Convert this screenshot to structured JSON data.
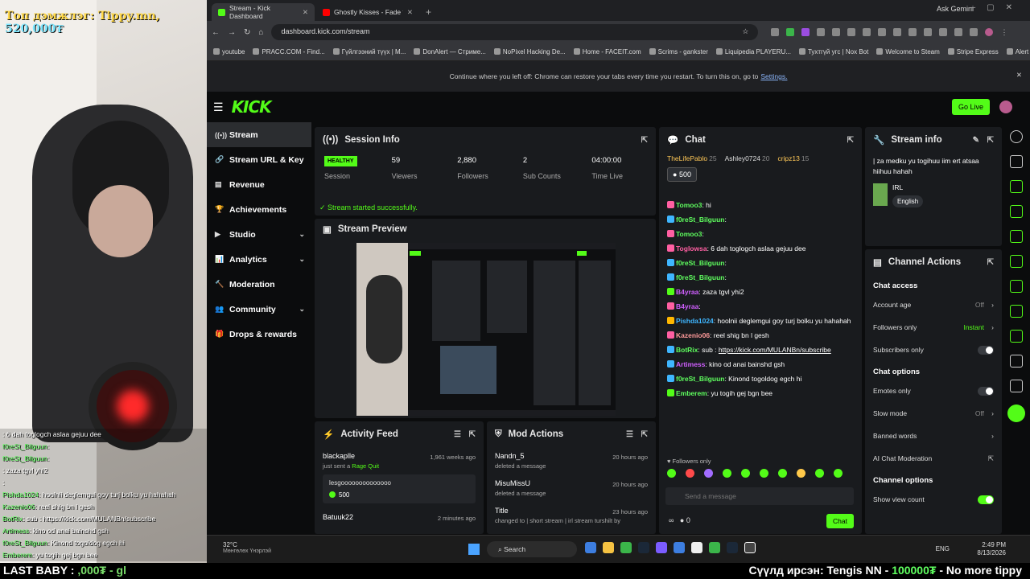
{
  "overlay": {
    "tip_prefix": "Топ дэмжлэг:",
    "tip_name": "Tippy.mn",
    "tip_amount": "520,000₮",
    "chat": [
      {
        "user": "",
        "text": ": 6 dah toglogch aslaa gejuu dee"
      },
      {
        "user": "f0reSt_Bilguun",
        "text": ":"
      },
      {
        "user": "f0reSt_Bilguun",
        "text": ":"
      },
      {
        "user": "",
        "text": ": zaza tgvl yhi2"
      },
      {
        "user": "",
        "text": ":"
      },
      {
        "user": "Pishda1024",
        "text": ": hoolnii deglemgui goy turj bolku yu hahahah"
      },
      {
        "user": "Kazenio06",
        "text": ": reel shig bn l gesh"
      },
      {
        "user": "BotRix",
        "text": ": sub : https://kick.com/MULANBn/subscribe"
      },
      {
        "user": "Artimess",
        "text": ": kino od anai bainshd gsh"
      },
      {
        "user": "f0reSt_Bilguun",
        "text": ": Kinond togoldog egch hi"
      },
      {
        "user": "Emberem",
        "text": ": yu togih gej bgn bee"
      }
    ],
    "bottom_left_label": "LAST BABY :",
    "bottom_left_value": ",000₮ - gl",
    "bottom_right_prefix": "Сүүлд ирсэн:",
    "bottom_right_name": "Tengis NN -",
    "bottom_right_amount": "100000₮",
    "bottom_right_suffix": "- No more tippy"
  },
  "browser": {
    "tabs": [
      {
        "title": "Stream - Kick Dashboard",
        "active": true
      },
      {
        "title": "Ghostly Kisses - Fade from Me",
        "active": false
      }
    ],
    "ask_gemini": "Ask Gemini",
    "url": "dashboard.kick.com/stream",
    "bookmarks": [
      "youtube",
      "PRACC.COM - Find...",
      "Гүйлгээний түүх | M...",
      "DonAlert — Стриме...",
      "NoPixel Hacking De...",
      "Home - FACEIT.com",
      "Scrims - gankster",
      "Liquipedia PLAYERU...",
      "Тухтгүй угс | Nox Bot",
      "Welcome to Steam",
      "Stripe Express",
      "Alert Box / Streamla...",
      "All Bookmarks"
    ],
    "restore_text": "Continue where you left off: Chrome can restore your tabs every time you restart. To turn this on, go to",
    "restore_link": "Settings."
  },
  "kick": {
    "logo": "KICK",
    "go_live": "Go Live",
    "nav": [
      {
        "label": "Stream",
        "icon": "((•))",
        "chev": ""
      },
      {
        "label": "Stream URL & Key",
        "icon": "🔗",
        "chev": ""
      },
      {
        "label": "Revenue",
        "icon": "▤",
        "chev": ""
      },
      {
        "label": "Achievements",
        "icon": "🏆",
        "chev": ""
      },
      {
        "label": "Studio",
        "icon": "▶",
        "chev": "⌄"
      },
      {
        "label": "Analytics",
        "icon": "📊",
        "chev": "⌄"
      },
      {
        "label": "Moderation",
        "icon": "🔨",
        "chev": ""
      },
      {
        "label": "Community",
        "icon": "👥",
        "chev": "⌄"
      },
      {
        "label": "Drops & rewards",
        "icon": "🎁",
        "chev": ""
      }
    ],
    "session": {
      "title": "Session Info",
      "badge": "HEALTHY",
      "badge_label": "Session",
      "stats": [
        {
          "value": "59",
          "label": "Viewers"
        },
        {
          "value": "2,880",
          "label": "Followers"
        },
        {
          "value": "2",
          "label": "Sub Counts"
        },
        {
          "value": "04:00:00",
          "label": "Time Live"
        }
      ],
      "success": "Stream started successfully."
    },
    "preview_title": "Stream Preview",
    "activity": {
      "title": "Activity Feed",
      "items": [
        {
          "name": "blackaplle",
          "sub": "just sent a",
          "sub_bold": "Rage Quit",
          "time": "1,961 weeks ago",
          "msg": "lesgoooooooooooooo",
          "amount": "500"
        },
        {
          "name": "Batuuk22",
          "sub": "",
          "sub_bold": "",
          "time": "2 minutes ago",
          "msg": "",
          "amount": ""
        }
      ]
    },
    "mod": {
      "title": "Mod Actions",
      "items": [
        {
          "name": "Nandn_5",
          "sub": "deleted a message",
          "time": "20 hours ago"
        },
        {
          "name": "MisuMissU",
          "sub": "deleted a message",
          "time": "20 hours ago"
        },
        {
          "name": "Title",
          "sub": "changed to | short stream | irl stream turshilt by",
          "time": "23 hours ago"
        }
      ]
    },
    "chat": {
      "title": "Chat",
      "top_users": [
        {
          "name": "TheLifePablo",
          "count": "25"
        },
        {
          "name": "Ashley0724",
          "count": "20"
        },
        {
          "name": "cripz13",
          "count": "15"
        }
      ],
      "pinned_amount": "500",
      "lines": [
        {
          "user": "Tomoo3",
          "color": "#5fff5f",
          "text": ": hi",
          "badge": "#ff5fa2"
        },
        {
          "user": "f0reSt_Bilguun",
          "color": "#5fff5f",
          "text": ":",
          "badge": "#3fb6ff"
        },
        {
          "user": "Tomoo3",
          "color": "#5fff5f",
          "text": ":",
          "badge": "#ff5fa2"
        },
        {
          "user": "Toglowsa",
          "color": "#ff5fa2",
          "text": ": 6 dah toglogch aslaa gejuu dee",
          "badge": "#ff5fa2"
        },
        {
          "user": "f0reSt_Bilguun",
          "color": "#5fff5f",
          "text": ":",
          "badge": "#3fb6ff"
        },
        {
          "user": "f0reSt_Bilguun",
          "color": "#5fff5f",
          "text": ":",
          "badge": "#3fb6ff"
        },
        {
          "user": "B4yraa",
          "color": "#d05fff",
          "text": ": zaza tgvl yhi2",
          "badge": "#53fc18"
        },
        {
          "user": "B4yraa",
          "color": "#d05fff",
          "text": ":",
          "badge": "#ff5fa2"
        },
        {
          "user": "Pishda1024",
          "color": "#3fb6ff",
          "text": ": hoolnii deglemgui goy turj bolku yu hahahah",
          "badge": "#ffb700"
        },
        {
          "user": "Kazenio06",
          "color": "#ff9a9a",
          "text": ": reel shig bn l gesh",
          "badge": "#ff5fa2"
        },
        {
          "user": "BotRix",
          "color": "#5fff5f",
          "text": ": sub :",
          "link": "https://kick.com/MULANBn/subscribe",
          "badge": "#3fb6ff"
        },
        {
          "user": "Artimess",
          "color": "#d05fff",
          "text": ": kino od anai bainshd gsh",
          "badge": "#3fb6ff"
        },
        {
          "user": "f0reSt_Bilguun",
          "color": "#5fff5f",
          "text": ": Kinond togoldog egch hi",
          "badge": "#3fb6ff"
        },
        {
          "user": "Emberem",
          "color": "#5fff5f",
          "text": ": yu togih gej bgn bee",
          "badge": "#53fc18"
        }
      ],
      "followers_only": "Followers only",
      "placeholder": "Send a message",
      "infinite": "∞",
      "points": "0",
      "send_label": "Chat"
    },
    "stream_info": {
      "title": "Stream info",
      "stream_title": "| za medku yu togihuu iim ert atsaa hiihuu hahah",
      "category": "IRL",
      "language": "English"
    },
    "channel_actions": {
      "title": "Channel Actions",
      "chat_access": "Chat access",
      "account_age": "Account age",
      "account_age_val": "Off",
      "followers_only": "Followers only",
      "followers_only_val": "Instant",
      "subscribers_only": "Subscribers only",
      "chat_options": "Chat options",
      "emotes_only": "Emotes only",
      "slow_mode": "Slow mode",
      "slow_mode_val": "Off",
      "banned_words": "Banned words",
      "ai_moderation": "AI Chat Moderation",
      "channel_options": "Channel options",
      "show_view_count": "Show view count"
    }
  },
  "taskbar": {
    "temp": "32°C",
    "weather": "Мөнгөлөх Үнэрлэй",
    "search": "Search",
    "lang": "ENG",
    "time": "2:49 PM",
    "date": "8/13/2026"
  }
}
